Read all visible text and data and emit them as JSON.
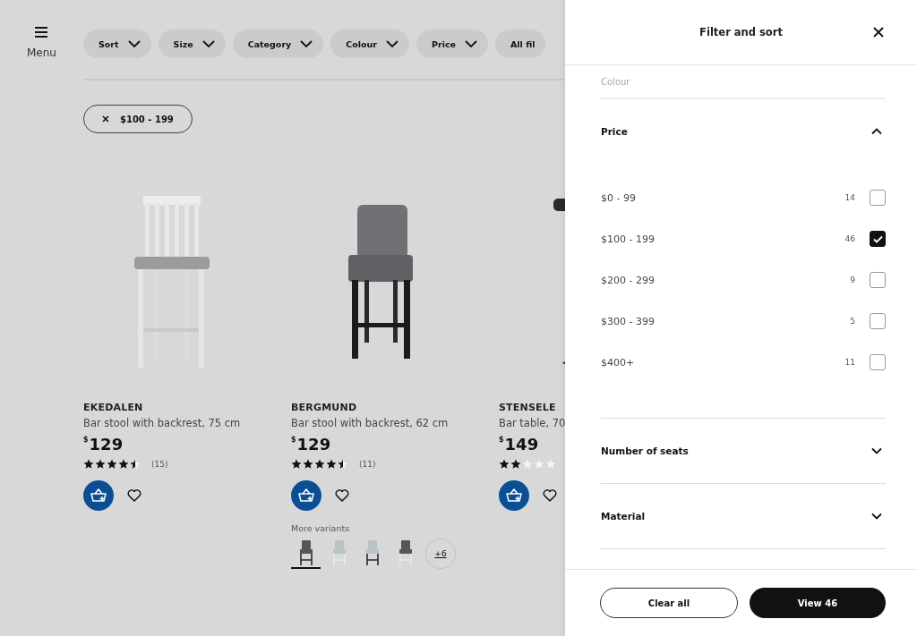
{
  "menu": {
    "label": "Menu"
  },
  "filter_chips": [
    {
      "label": "Sort",
      "kind": "dropdown"
    },
    {
      "label": "Size",
      "kind": "dropdown"
    },
    {
      "label": "Category",
      "kind": "dropdown"
    },
    {
      "label": "Colour",
      "kind": "dropdown"
    },
    {
      "label": "Price",
      "kind": "dropdown"
    },
    {
      "label": "All fil",
      "kind": "plain"
    }
  ],
  "active_filters": [
    {
      "label": "$100 - 199"
    }
  ],
  "products": [
    {
      "kind": "stool-light",
      "name": "EKEDALEN",
      "description": "Bar stool with backrest, 75 cm",
      "currency": "$",
      "price": "129",
      "stars": 4.5,
      "reviews": "(15)"
    },
    {
      "kind": "stool-dark",
      "name": "BERGMUND",
      "description": "Bar stool with backrest, 62 cm",
      "currency": "$",
      "price": "129",
      "stars": 4.5,
      "reviews": "(11)",
      "variants": {
        "label": "More variants",
        "more": "+6",
        "thumbnails": [
          {
            "kind": "dark-frame",
            "color": "#55575a",
            "selected": true
          },
          {
            "kind": "light-frame",
            "color": "#b9c3c6",
            "selected": false
          },
          {
            "kind": "dark-frame",
            "color": "#b9c3c6",
            "selected": false
          },
          {
            "kind": "light-frame",
            "color": "#55575a",
            "selected": false
          }
        ]
      }
    },
    {
      "kind": "table",
      "name": "STENSELE",
      "description": "Bar table, 70",
      "currency": "$",
      "price": "149",
      "stars": 2
    }
  ],
  "panel": {
    "title": "Filter and sort",
    "scrolled_section": {
      "label": "Colour"
    },
    "sections": [
      {
        "label": "Price",
        "expanded": true,
        "options": [
          {
            "label": "$0 - 99",
            "count": "14",
            "checked": false
          },
          {
            "label": "$100 - 199",
            "count": "46",
            "checked": true
          },
          {
            "label": "$200 - 299",
            "count": "9",
            "checked": false
          },
          {
            "label": "$300 - 399",
            "count": "5",
            "checked": false
          },
          {
            "label": "$400+",
            "count": "11",
            "checked": false
          }
        ]
      },
      {
        "label": "Number of seats",
        "expanded": false
      },
      {
        "label": "Material",
        "expanded": false
      }
    ],
    "clear_button": "Clear all",
    "view_button": "View 46"
  }
}
